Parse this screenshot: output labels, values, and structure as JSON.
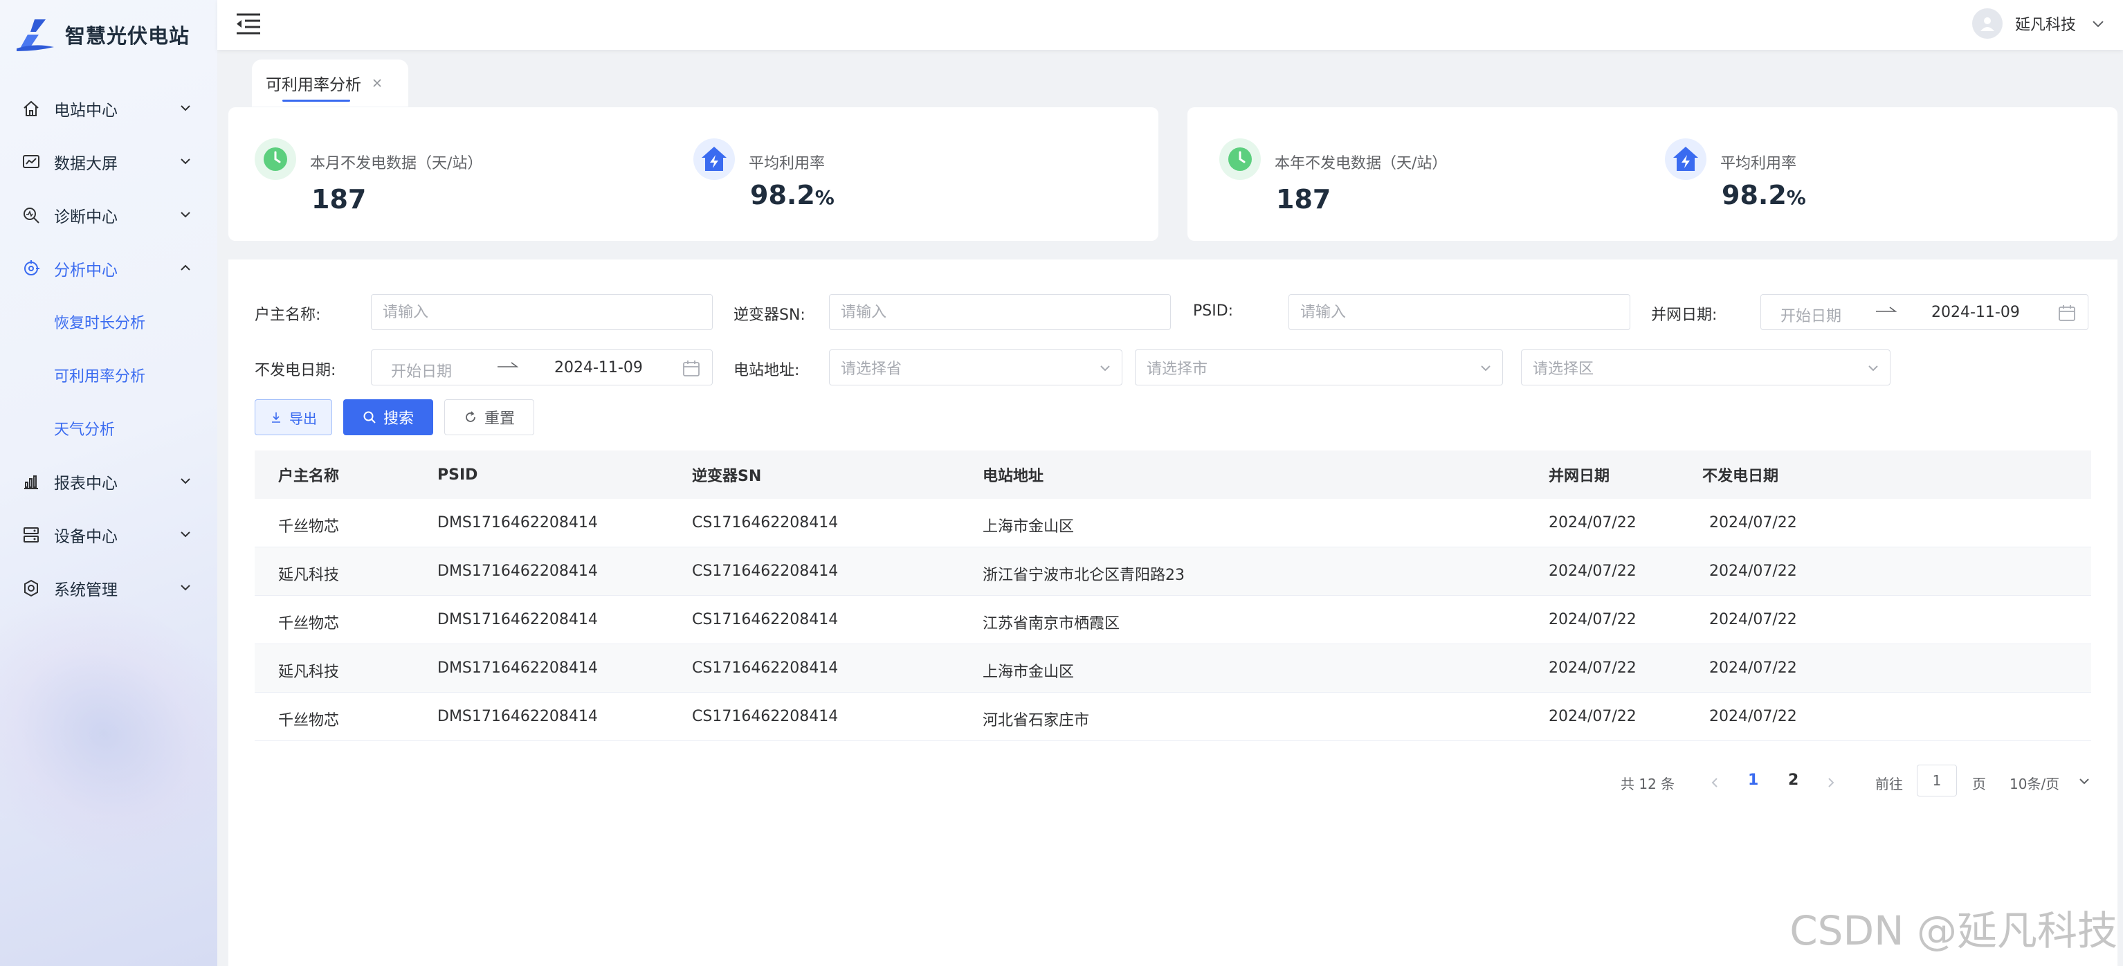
{
  "app": {
    "title": "智慧光伏电站"
  },
  "sidebar": {
    "items": [
      {
        "label": "电站中心",
        "icon": "home-icon"
      },
      {
        "label": "数据大屏",
        "icon": "dashboard-icon"
      },
      {
        "label": "诊断中心",
        "icon": "diagnosis-icon"
      },
      {
        "label": "分析中心",
        "icon": "analysis-icon",
        "expanded": true,
        "children": [
          {
            "label": "恢复时长分析"
          },
          {
            "label": "可利用率分析",
            "active": true
          },
          {
            "label": "天气分析"
          }
        ]
      },
      {
        "label": "报表中心",
        "icon": "report-icon"
      },
      {
        "label": "设备中心",
        "icon": "device-icon"
      },
      {
        "label": "系统管理",
        "icon": "settings-icon"
      }
    ]
  },
  "header": {
    "user_name": "延凡科技"
  },
  "tabs": [
    {
      "label": "可利用率分析",
      "active": true
    }
  ],
  "stats": {
    "month": {
      "label": "本月不发电数据（天/站）",
      "value": "187"
    },
    "month_rate": {
      "label": "平均利用率",
      "value": "98.2",
      "unit": "%"
    },
    "year": {
      "label": "本年不发电数据（天/站）",
      "value": "187"
    },
    "year_rate": {
      "label": "平均利用率",
      "value": "98.2",
      "unit": "%"
    }
  },
  "filters": {
    "owner_label": "户主名称:",
    "owner_placeholder": "请输入",
    "inverter_label": "逆变器SN:",
    "inverter_placeholder": "请输入",
    "psid_label": "PSID:",
    "psid_placeholder": "请输入",
    "grid_date_label": "并网日期:",
    "grid_date_start_placeholder": "开始日期",
    "grid_date_end": "2024-11-09",
    "nogen_date_label": "不发电日期:",
    "nogen_date_start_placeholder": "开始日期",
    "nogen_date_end": "2024-11-09",
    "address_label": "电站地址:",
    "province_placeholder": "请选择省",
    "city_placeholder": "请选择市",
    "district_placeholder": "请选择区"
  },
  "buttons": {
    "export": "导出",
    "search": "搜索",
    "reset": "重置"
  },
  "table": {
    "columns": [
      "户主名称",
      "PSID",
      "逆变器SN",
      "电站地址",
      "并网日期",
      "不发电日期"
    ],
    "rows": [
      [
        "千丝物芯",
        "DMS1716462208414",
        "CS1716462208414",
        "上海市金山区",
        "2024/07/22",
        "2024/07/22"
      ],
      [
        "延凡科技",
        "DMS1716462208414",
        "CS1716462208414",
        "浙江省宁波市北仑区青阳路23",
        "2024/07/22",
        "2024/07/22"
      ],
      [
        "千丝物芯",
        "DMS1716462208414",
        "CS1716462208414",
        "江苏省南京市栖霞区",
        "2024/07/22",
        "2024/07/22"
      ],
      [
        "延凡科技",
        "DMS1716462208414",
        "CS1716462208414",
        "上海市金山区",
        "2024/07/22",
        "2024/07/22"
      ],
      [
        "千丝物芯",
        "DMS1716462208414",
        "CS1716462208414",
        "河北省石家庄市",
        "2024/07/22",
        "2024/07/22"
      ]
    ]
  },
  "pagination": {
    "total_text": "共 12 条",
    "pages": [
      "1",
      "2"
    ],
    "current": "1",
    "goto_label": "前往",
    "goto_value": "1",
    "page_suffix": "页",
    "page_size": "10条/页"
  },
  "watermark": "CSDN @延凡科技",
  "colors": {
    "accent": "#3a6bf0",
    "green": "#5ccf7e",
    "sidebar_bg": "#eef2fb"
  }
}
